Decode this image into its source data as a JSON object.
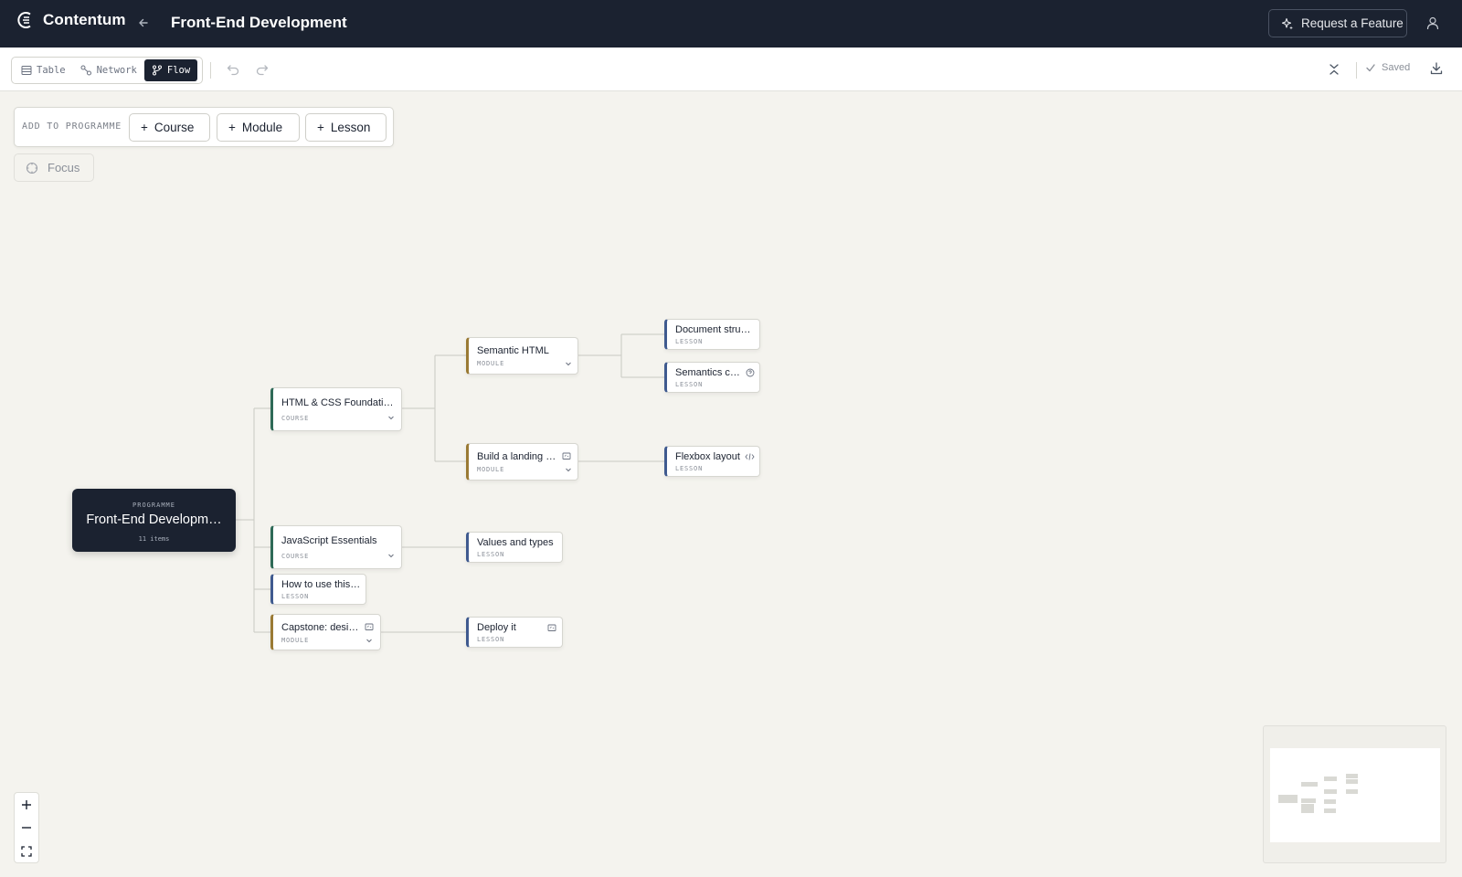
{
  "app": {
    "name": "Contentum",
    "page_title": "Front-End Development",
    "request_feature": "Request a Feature"
  },
  "toolbar": {
    "views": [
      {
        "label": "Table"
      },
      {
        "label": "Network"
      },
      {
        "label": "Flow",
        "active": true
      }
    ],
    "saved_label": "Saved"
  },
  "add_panel": {
    "label": "ADD TO PROGRAMME",
    "buttons": [
      "Course",
      "Module",
      "Lesson"
    ]
  },
  "focus_label": "Focus",
  "flow": {
    "root": {
      "type": "PROGRAMME",
      "title": "Front-End Developm…",
      "count": "11 items"
    },
    "nodes": {
      "html_css": {
        "title": "HTML & CSS Foundations",
        "type": "COURSE"
      },
      "semantic_html": {
        "title": "Semantic HTML",
        "type": "MODULE"
      },
      "document_structure": {
        "title": "Document struct…",
        "type": "LESSON"
      },
      "semantics_check": {
        "title": "Semantics ch…",
        "type": "LESSON"
      },
      "landing_page": {
        "title": "Build a landing pa…",
        "type": "MODULE"
      },
      "flexbox": {
        "title": "Flexbox layout",
        "type": "LESSON"
      },
      "js_essentials": {
        "title": "JavaScript Essentials",
        "type": "COURSE"
      },
      "values_types": {
        "title": "Values and types",
        "type": "LESSON"
      },
      "how_to_use": {
        "title": "How to use this p…",
        "type": "LESSON"
      },
      "capstone": {
        "title": "Capstone: design…",
        "type": "MODULE"
      },
      "deploy": {
        "title": "Deploy it",
        "type": "LESSON"
      }
    }
  },
  "colors": {
    "header_bg": "#1b2230",
    "canvas_bg": "#f4f3ee",
    "course_accent": "#2e6a57",
    "module_accent": "#9a7a34",
    "lesson_accent": "#3f5a8f"
  }
}
